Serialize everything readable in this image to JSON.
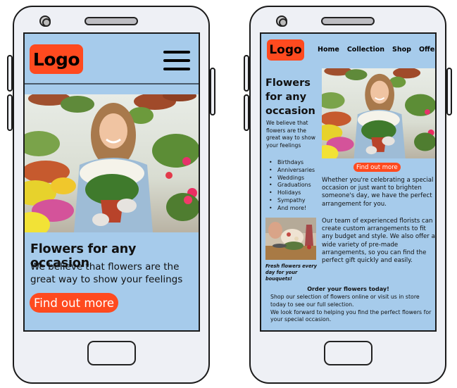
{
  "mobile_menu_layout": {
    "logo": "Logo",
    "menu_icon": "hamburger-menu-icon",
    "hero_image_alt": "Smiling woman holding a pot of white flowers in a greenhouse",
    "title": "Flowers for any occasion",
    "lead": "We believe that flowers are the great way to show your feelings",
    "cta": "Find out more"
  },
  "mobile_full_layout": {
    "logo": "Logo",
    "nav": [
      "Home",
      "Collection",
      "Shop",
      "Offers"
    ],
    "title": "Flowers for any occasion",
    "lead": "We believe that flowers are the great way to show your feelings",
    "occasions": [
      "Birthdays",
      "Anniversaries",
      "Weddings",
      "Graduations",
      "Holidays",
      "Sympathy",
      "And more!"
    ],
    "hero_image_alt": "Smiling woman holding a pot of white flowers in a greenhouse",
    "cta": "Find out more",
    "paragraph_1": "Whether you're celebrating a special occasion or just want to brighten someone's day, we have the perfect arrangement for you.",
    "florist_image_alt": "Florist arranging a bouquet",
    "caption": "Fresh flowers every day for your bouquets!",
    "paragraph_2": "Our team of experienced florists can create custom arrangements to fit any budget and style. We also offer a wide variety of pre-made arrangements, so you can find the perfect gift quickly and easily.",
    "order_title": "Order your flowers today!",
    "order_text_1": "Shop our selection of flowers online or visit us in store today to see our full selection.",
    "order_text_2": "We look forward to helping you find the perfect flowers for your special occasion."
  },
  "colors": {
    "screen_bg": "#a6cbeb",
    "accent": "#ff4a1f",
    "phone_body": "#eef0f5",
    "outline": "#1a1a1a"
  }
}
